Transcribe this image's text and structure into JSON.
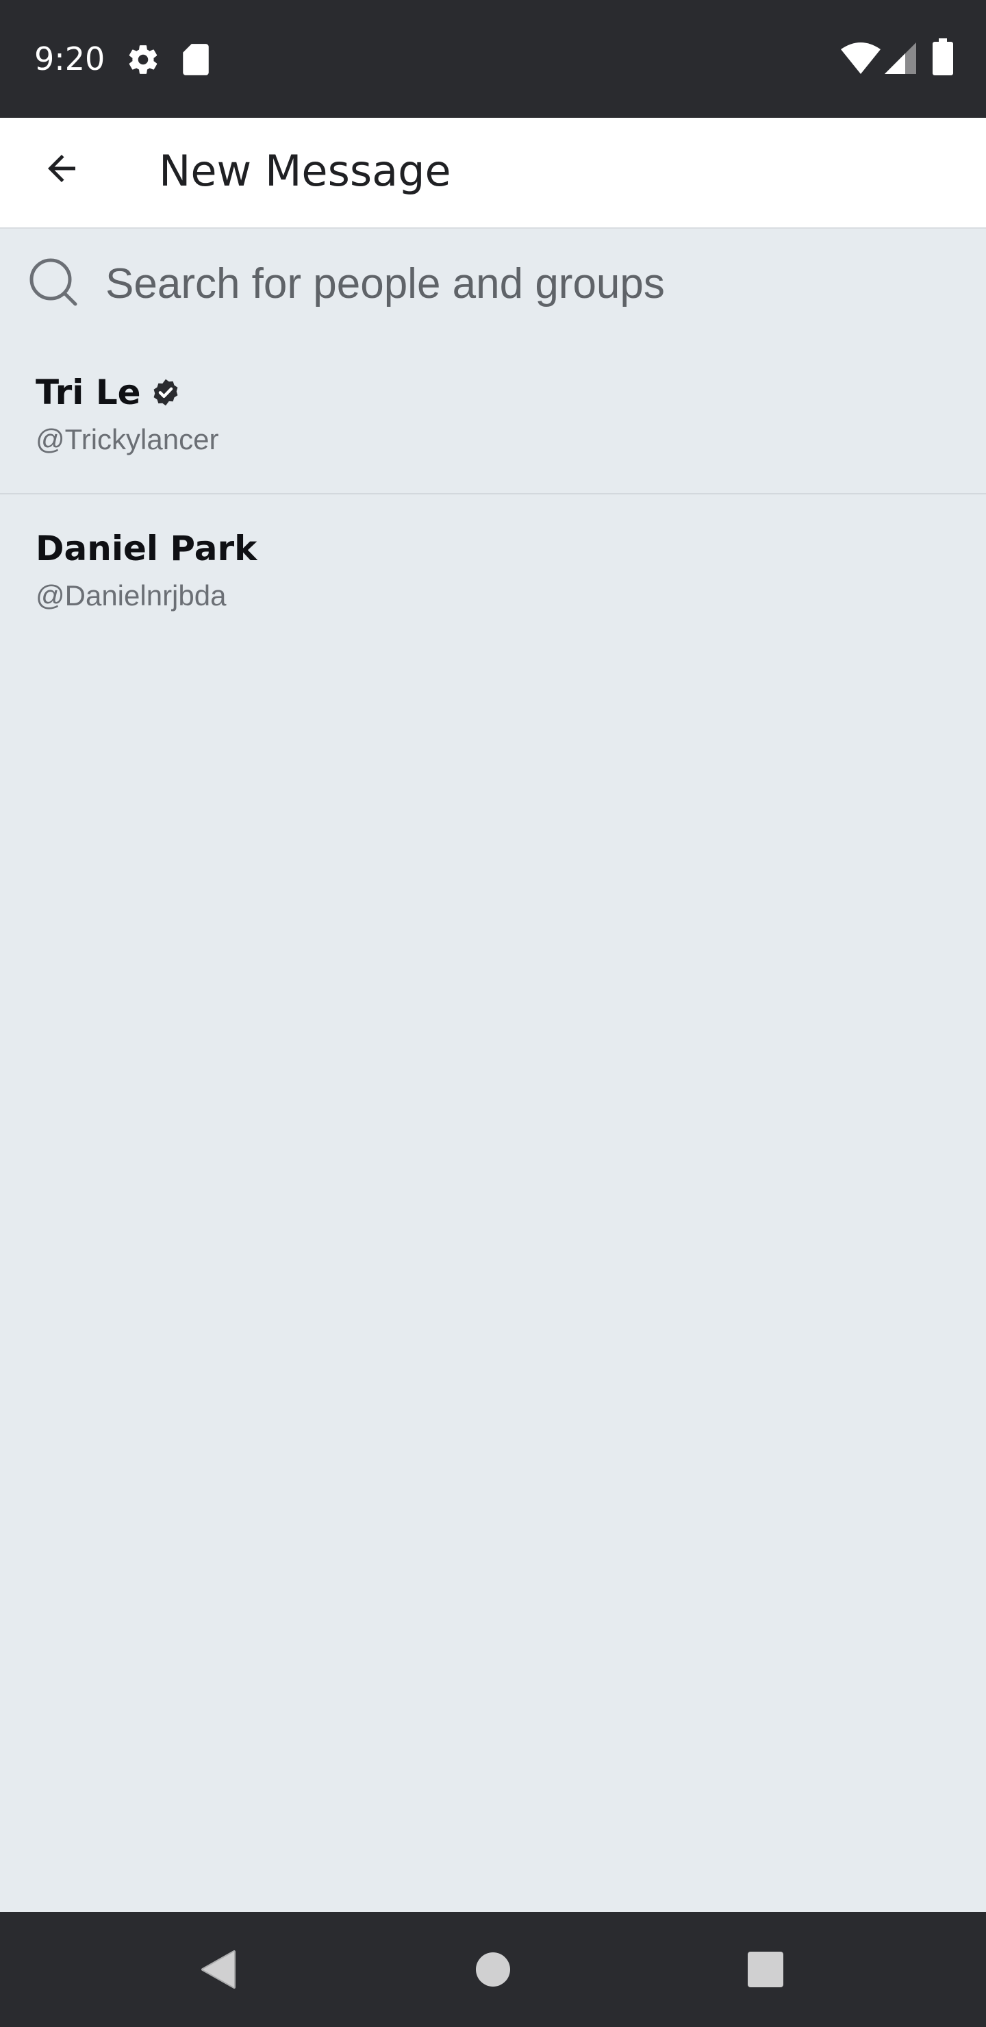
{
  "status_bar": {
    "time": "9:20",
    "icons": [
      "settings-gear-icon",
      "sd-card-icon",
      "wifi-icon",
      "cellular-signal-icon",
      "battery-icon"
    ]
  },
  "app_bar": {
    "back_icon": "arrow-left-icon",
    "title": "New Message"
  },
  "search": {
    "icon": "search-icon",
    "placeholder": "Search for people and groups",
    "value": ""
  },
  "contacts": [
    {
      "name": "Tri Le",
      "verified": true,
      "handle": "@Trickylancer"
    },
    {
      "name": "Daniel Park",
      "verified": false,
      "handle": "@Danielnrjbda"
    }
  ],
  "nav_bar": {
    "icons": [
      "back-triangle-icon",
      "home-circle-icon",
      "recents-square-icon"
    ]
  },
  "colors": {
    "status_bar_bg": "#2a2b2f",
    "app_bar_bg": "#ffffff",
    "content_bg": "#e6ebef",
    "title_text": "#1f2023",
    "handle_text": "#6b6f75"
  }
}
